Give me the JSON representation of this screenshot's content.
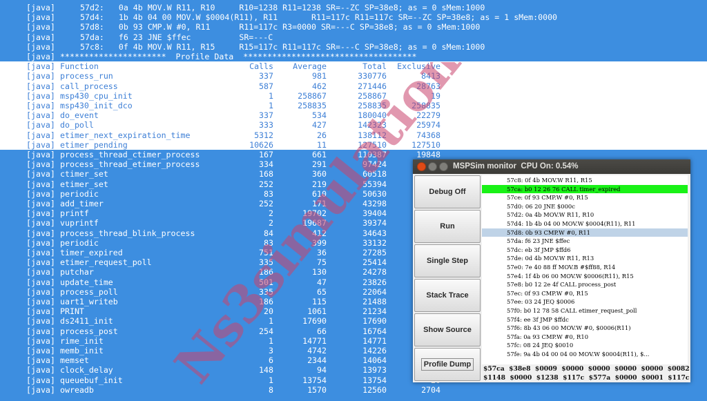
{
  "terminal": {
    "prefix": "[java]",
    "header_divider": "**********************  Profile Data  ************************************",
    "header": {
      "function": "Function",
      "calls": "Calls",
      "average": "Average",
      "total": "Total",
      "exclusive": "Exclusive"
    },
    "trace_lines": [
      "57d2:   0a 4b MOV.W R11, R10     R10=1238 R11=1238 SR=--ZC SP=38e8; as = 0 sMem:1000",
      "57d4:   1b 4b 04 00 MOV.W $0004(R11), R11       R11=117c R11=117c SR=--ZC SP=38e8; as = 1 sMem:0000",
      "57d8:   0b 93 CMP.W #0, R11      R11=117c R3=0000 SR=---C SP=38e8; as = 0 sMem:1000",
      "57da:   f6 23 JNE $ffec          SR=---C",
      "57c8:   0f 4b MOV.W R11, R15     R15=117c R11=117c SR=---C SP=38e8; as = 0 sMem:1000"
    ],
    "rows": [
      {
        "fn": "process_run",
        "calls": "337",
        "avg": "981",
        "total": "330776",
        "excl": "8413"
      },
      {
        "fn": "call_process",
        "calls": "587",
        "avg": "462",
        "total": "271446",
        "excl": "28763"
      },
      {
        "fn": "msp430_cpu_init",
        "calls": "1",
        "avg": "258867",
        "total": "258867",
        "excl": "19"
      },
      {
        "fn": "msp430_init_dco",
        "calls": "1",
        "avg": "258835",
        "total": "258835",
        "excl": "258835"
      },
      {
        "fn": "do_event",
        "calls": "337",
        "avg": "534",
        "total": "180040",
        "excl": "22279"
      },
      {
        "fn": "do_poll",
        "calls": "333",
        "avg": "427",
        "total": "142323",
        "excl": "25974"
      },
      {
        "fn": "etimer_next_expiration_time",
        "calls": "5312",
        "avg": "26",
        "total": "138112",
        "excl": "74368"
      },
      {
        "fn": "etimer_pending",
        "calls": "10626",
        "avg": "11",
        "total": "127510",
        "excl": "127510"
      },
      {
        "fn": "process_thread_ctimer_process",
        "calls": "167",
        "avg": "661",
        "total": "110387",
        "excl": "19848"
      },
      {
        "fn": "process_thread_etimer_process",
        "calls": "334",
        "avg": "291",
        "total": "97424",
        "excl": ""
      },
      {
        "fn": "ctimer_set",
        "calls": "168",
        "avg": "360",
        "total": "60518",
        "excl": ""
      },
      {
        "fn": "etimer_set",
        "calls": "252",
        "avg": "219",
        "total": "55394",
        "excl": ""
      },
      {
        "fn": "periodic",
        "calls": "83",
        "avg": "610",
        "total": "50630",
        "excl": ""
      },
      {
        "fn": "add_timer",
        "calls": "252",
        "avg": "171",
        "total": "43298",
        "excl": ""
      },
      {
        "fn": "printf",
        "calls": "2",
        "avg": "19702",
        "total": "39404",
        "excl": ""
      },
      {
        "fn": "vuprintf",
        "calls": "2",
        "avg": "19687",
        "total": "39374",
        "excl": ""
      },
      {
        "fn": "process_thread_blink_process",
        "calls": "84",
        "avg": "412",
        "total": "34643",
        "excl": ""
      },
      {
        "fn": "periodic",
        "calls": "83",
        "avg": "399",
        "total": "33132",
        "excl": ""
      },
      {
        "fn": "timer_expired",
        "calls": "751",
        "avg": "36",
        "total": "27285",
        "excl": ""
      },
      {
        "fn": "etimer_request_poll",
        "calls": "335",
        "avg": "75",
        "total": "25414",
        "excl": ""
      },
      {
        "fn": "putchar",
        "calls": "186",
        "avg": "130",
        "total": "24278",
        "excl": ""
      },
      {
        "fn": "update_time",
        "calls": "501",
        "avg": "47",
        "total": "23826",
        "excl": ""
      },
      {
        "fn": "process_poll",
        "calls": "335",
        "avg": "65",
        "total": "22064",
        "excl": ""
      },
      {
        "fn": "uart1_writeb",
        "calls": "186",
        "avg": "115",
        "total": "21488",
        "excl": ""
      },
      {
        "fn": "PRINT",
        "calls": "20",
        "avg": "1061",
        "total": "21234",
        "excl": ""
      },
      {
        "fn": "ds2411_init",
        "calls": "1",
        "avg": "17690",
        "total": "17690",
        "excl": ""
      },
      {
        "fn": "process_post",
        "calls": "254",
        "avg": "66",
        "total": "16764",
        "excl": ""
      },
      {
        "fn": "rime_init",
        "calls": "1",
        "avg": "14771",
        "total": "14771",
        "excl": ""
      },
      {
        "fn": "memb_init",
        "calls": "3",
        "avg": "4742",
        "total": "14226",
        "excl": ""
      },
      {
        "fn": "memset",
        "calls": "6",
        "avg": "2344",
        "total": "14064",
        "excl": ""
      },
      {
        "fn": "clock_delay",
        "calls": "148",
        "avg": "94",
        "total": "13973",
        "excl": ""
      },
      {
        "fn": "queuebuf_init",
        "calls": "1",
        "avg": "13754",
        "total": "13754",
        "excl": "20"
      },
      {
        "fn": "owreadb",
        "calls": "8",
        "avg": "1570",
        "total": "12560",
        "excl": "2704"
      }
    ]
  },
  "watermark": {
    "text": "Ns3simulation.com"
  },
  "monitor": {
    "title": "MSPSim monitor  CPU On: 0.54%",
    "buttons": [
      "Debug Off",
      "Run",
      "Single Step",
      "Stack Trace",
      "Show Source",
      "Profile Dump"
    ],
    "code_lines": [
      "57c8: 0f 4b MOV.W R11, R15",
      "57ca: b0 12 26 76 CALL timer_expired",
      "57ce: 0f 93 CMP.W #0, R15",
      "57d0: 06 20 JNE $000c",
      "57d2: 0a 4b MOV.W R11, R10",
      "57d4: 1b 4b 04 00 MOV.W $0004(R11), R11",
      "57d8: 0b 93 CMP.W #0, R11",
      "57da: f6 23 JNE $ffec",
      "57dc: eb 3f JMP $ffd6",
      "57de: 0d 4b MOV.W R11, R13",
      "57e0: 7e 40 88 ff MOV.B #$ff88, R14",
      "57e4: 1f 4b 06 00 MOV.W $0006(R11), R15",
      "57e8: b0 12 2e 4f CALL process_post",
      "57ec: 0f 93 CMP.W #0, R15",
      "57ee: 03 24 JEQ $0006",
      "57f0: b0 12 78 58 CALL etimer_request_poll",
      "57f4: ee 3f JMP $ffdc",
      "57f6: 8b 43 06 00 MOV.W #0, $0006(R11)",
      "57fa: 0a 93 CMP.W #0, R10",
      "57fc: 08 24 JEQ $0010",
      "57fe: 9a 4b 04 00 04 00 MOV.W $0004(R11), $..."
    ],
    "green_index": 1,
    "blue_index": 6,
    "registers": [
      "$57ca  $38e8  $0009  $0000  $0000  $0000  $0000  $0082",
      "$1148  $0000  $1238  $117c  $577a  $0000  $0001  $117c"
    ]
  },
  "colors": {
    "selection_bg": "#3d8ee0",
    "terminal_fg_on_white": "#3d7fd6",
    "pc_highlight": "#19f217",
    "watermark": "#c8446e"
  }
}
